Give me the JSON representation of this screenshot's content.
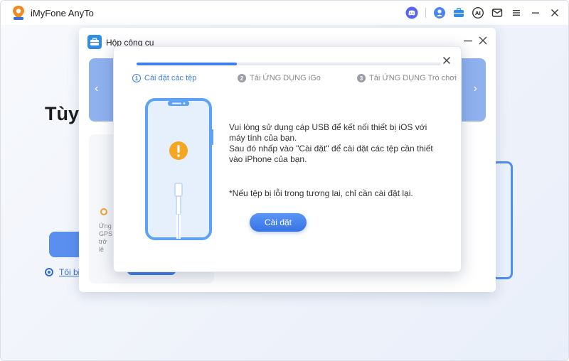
{
  "app": {
    "title": "iMyFone AnyTo"
  },
  "titlebar_icons": [
    "discord-icon",
    "user-icon",
    "toolbox-icon",
    "ai-icon",
    "mail-icon",
    "menu-icon",
    "minimize-icon",
    "close-icon"
  ],
  "background": {
    "heading": "Tùy hoạ bạn hoạ",
    "link_text": "Tôi bi"
  },
  "toolbox": {
    "title": "Hộp công cụ",
    "card_text": "Ứng GPS trở lê"
  },
  "install_dialog": {
    "progress_fraction": 0.33,
    "steps": [
      {
        "number": "1",
        "label": "Cài đặt các tệp",
        "state": "active"
      },
      {
        "number": "2",
        "label": "Tải ỨNG DỤNG iGo",
        "state": "inactive"
      },
      {
        "number": "3",
        "label": "Tải ỨNG DỤNG Trò chơi",
        "state": "inactive"
      }
    ],
    "instruction_line1": "Vui lòng sử dụng cáp USB để kết nối thiết bị iOS với máy tính của bạn.",
    "instruction_line2": "Sau đó nhấp vào \"Cài đặt\" để cài đặt các tệp cần thiết vào iPhone của bạn.",
    "note": "*Nếu tệp bị lỗi trong tương lai, chỉ cần cài đặt lại.",
    "install_button": "Cài đặt"
  },
  "colors": {
    "accent": "#3f7fea",
    "warning": "#f5a623"
  }
}
